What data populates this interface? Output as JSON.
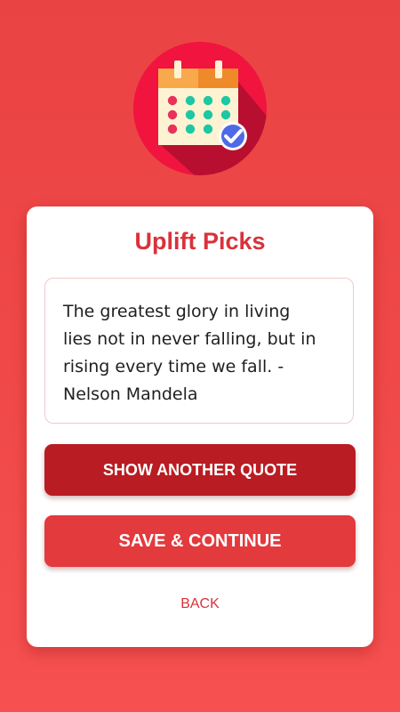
{
  "app": {
    "title": "Uplift Picks"
  },
  "logo": {
    "icon": "calendar-check-icon",
    "circle_color": "#f0143f"
  },
  "quote": {
    "text": "The greatest glory in living lies not in never falling, but in rising every time we fall. - Nelson Mandela"
  },
  "buttons": {
    "show_another": "SHOW ANOTHER QUOTE",
    "save_continue": "SAVE & CONTINUE",
    "back": "BACK"
  },
  "colors": {
    "background": "#ee4545",
    "accent": "#d9323b",
    "primary_dark": "#b91c22",
    "primary": "#e33a3d"
  }
}
